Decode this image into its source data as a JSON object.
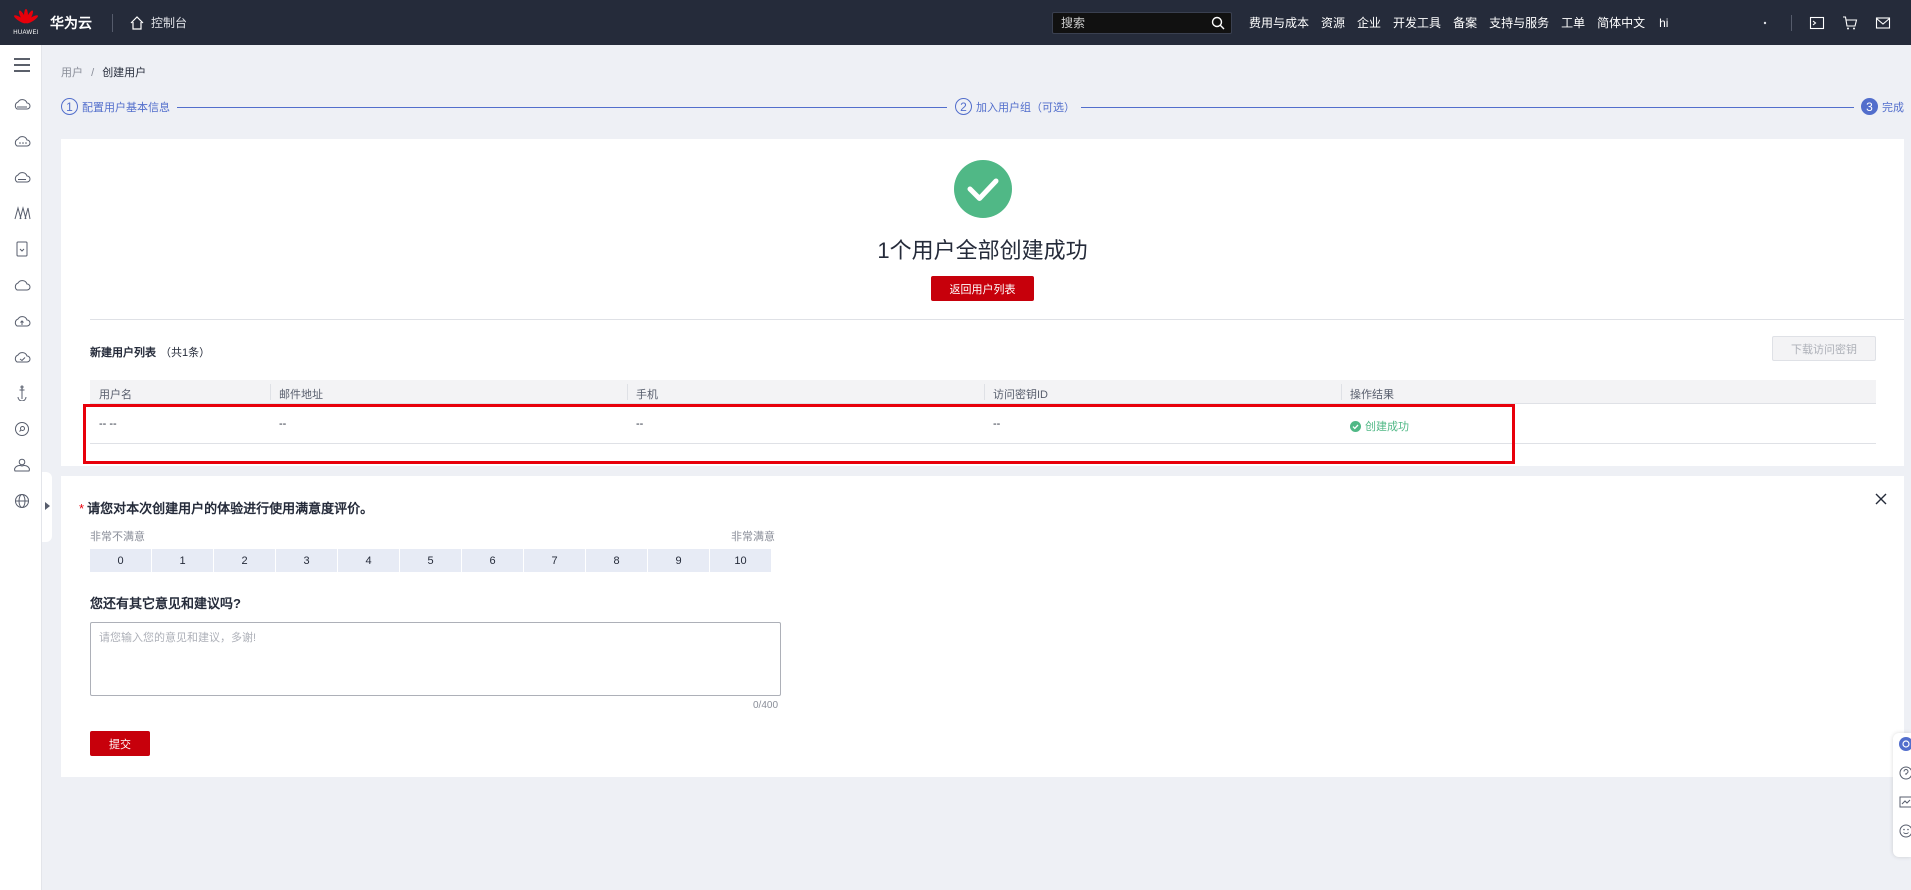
{
  "topbar": {
    "logo_text": "HUAWEI",
    "brand": "华为云",
    "console": "控制台",
    "search_placeholder": "搜索",
    "nav": [
      "费用与成本",
      "资源",
      "企业",
      "开发工具",
      "备案",
      "支持与服务",
      "工单",
      "简体中文"
    ],
    "nav_extra": "hi"
  },
  "breadcrumb": {
    "parent": "用户",
    "separator": "/",
    "current": "创建用户"
  },
  "steps": [
    {
      "num": "1",
      "label": "配置用户基本信息"
    },
    {
      "num": "2",
      "label": "加入用户组（可选）"
    },
    {
      "num": "3",
      "label": "完成"
    }
  ],
  "result": {
    "title": "1个用户全部创建成功",
    "back_button": "返回用户列表"
  },
  "user_list": {
    "title": "新建用户列表",
    "count": "（共1条）",
    "download_button": "下载访问密钥",
    "columns": [
      "用户名",
      "邮件地址",
      "手机",
      "访问密钥ID",
      "操作结果"
    ],
    "rows": [
      {
        "username": "-- --",
        "email": "--",
        "phone": "--",
        "access_key": "--",
        "result": "创建成功"
      }
    ]
  },
  "feedback": {
    "question": "请您对本次创建用户的体验进行使用满意度评价。",
    "low_label": "非常不满意",
    "high_label": "非常满意",
    "scores": [
      "0",
      "1",
      "2",
      "3",
      "4",
      "5",
      "6",
      "7",
      "8",
      "9",
      "10"
    ],
    "question2": "您还有其它意见和建议吗?",
    "placeholder": "请您输入您的意见和建议，多谢!",
    "counter": "0/400",
    "submit": "提交"
  },
  "colors": {
    "topbar": "#252b3a",
    "primary_red": "#c7000b",
    "step_blue": "#526ecc",
    "success_green": "#50b886",
    "highlight_red": "#e8000b"
  }
}
